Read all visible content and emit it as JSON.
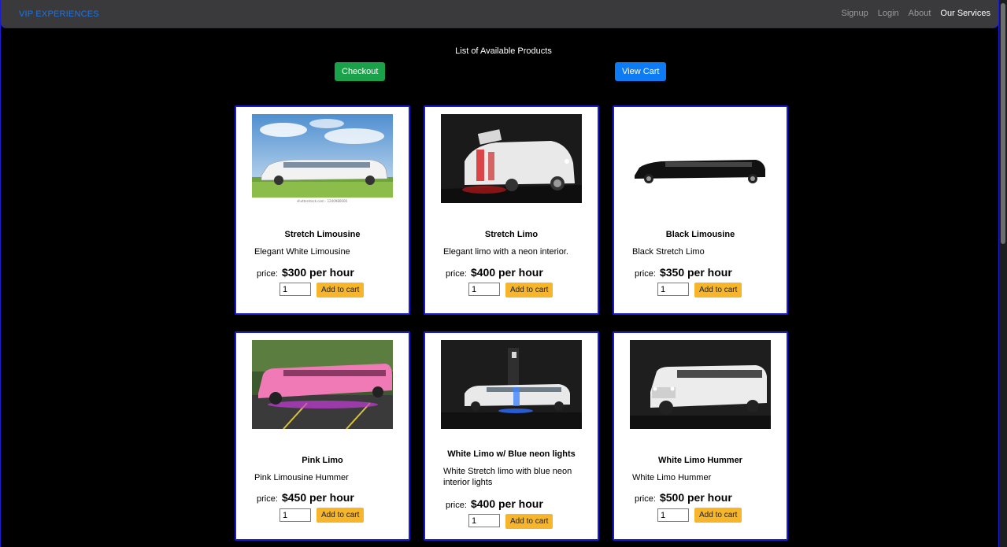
{
  "nav": {
    "brand": "VIP EXPERIENCES",
    "links": [
      "Signup",
      "Login",
      "About",
      "Our Services"
    ]
  },
  "heading": "List of Available Products",
  "buttons": {
    "checkout": "Checkout",
    "view_cart": "View Cart"
  },
  "colors": {
    "accent": "#0d7bf4",
    "checkout": "#19a24a",
    "add_to_cart": "#f7b52b",
    "card_border": "#1c1ccf"
  },
  "products": [
    {
      "title": "Stretch Limousine",
      "description": "Elegant White Limousine",
      "price_label": "price:",
      "price": "$300 per hour",
      "qty": "1",
      "add_label": "Add to cart",
      "image_caption": "shutterstock.com · 1240980000"
    },
    {
      "title": "Stretch Limo",
      "description": "Elegant limo with a neon interior.",
      "price_label": "price:",
      "price": "$400 per hour",
      "qty": "1",
      "add_label": "Add to cart"
    },
    {
      "title": "Black Limousine",
      "description": "Black Stretch Limo",
      "price_label": "price:",
      "price": "$350 per hour",
      "qty": "1",
      "add_label": "Add to cart"
    },
    {
      "title": "Pink Limo",
      "description": "Pink Limousine Hummer",
      "price_label": "price:",
      "price": "$450 per hour",
      "qty": "1",
      "add_label": "Add to cart"
    },
    {
      "title": "White Limo w/ Blue neon lights",
      "description": "White Stretch limo with blue neon interior lights",
      "price_label": "price:",
      "price": "$400 per hour",
      "qty": "1",
      "add_label": "Add to cart"
    },
    {
      "title": "White Limo Hummer",
      "description": "White Limo Hummer",
      "price_label": "price:",
      "price": "$500 per hour",
      "qty": "1",
      "add_label": "Add to cart"
    }
  ]
}
